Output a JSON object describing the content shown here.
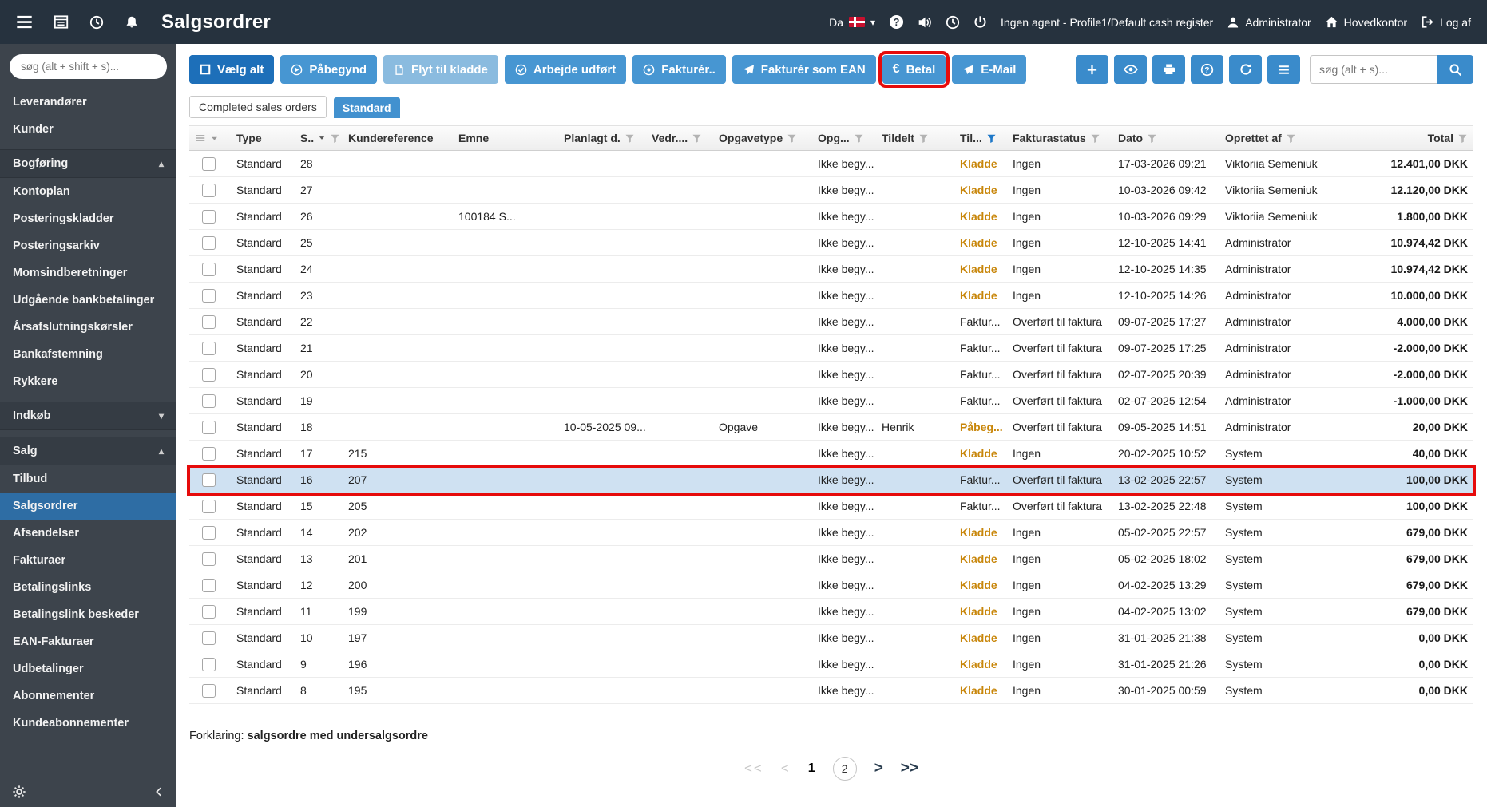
{
  "topbar": {
    "title": "Salgsordrer",
    "language": "Da",
    "agent_status": "Ingen agent - Profile1/Default cash register",
    "user": "Administrator",
    "location": "Hovedkontor",
    "logout_label": "Log af"
  },
  "sidebar": {
    "search_placeholder": "søg (alt + shift + s)...",
    "items": [
      {
        "label": "Leverandører",
        "type": "link"
      },
      {
        "label": "Kunder",
        "type": "link"
      },
      {
        "label": "Bogføring",
        "type": "section",
        "state": "expanded"
      },
      {
        "label": "Kontoplan",
        "type": "child"
      },
      {
        "label": "Posteringskladder",
        "type": "child"
      },
      {
        "label": "Posteringsarkiv",
        "type": "child"
      },
      {
        "label": "Momsindberetninger",
        "type": "child"
      },
      {
        "label": "Udgående bankbetalinger",
        "type": "child"
      },
      {
        "label": "Årsafslutningskørsler",
        "type": "child"
      },
      {
        "label": "Bankafstemning",
        "type": "child"
      },
      {
        "label": "Rykkere",
        "type": "child"
      },
      {
        "label": "Indkøb",
        "type": "section",
        "state": "collapsed"
      },
      {
        "label": "Salg",
        "type": "section",
        "state": "expanded"
      },
      {
        "label": "Tilbud",
        "type": "child"
      },
      {
        "label": "Salgsordrer",
        "type": "child",
        "active": true
      },
      {
        "label": "Afsendelser",
        "type": "child"
      },
      {
        "label": "Fakturaer",
        "type": "child"
      },
      {
        "label": "Betalingslinks",
        "type": "child"
      },
      {
        "label": "Betalingslink beskeder",
        "type": "child"
      },
      {
        "label": "EAN-Fakturaer",
        "type": "child"
      },
      {
        "label": "Udbetalinger",
        "type": "child"
      },
      {
        "label": "Abonnementer",
        "type": "child"
      },
      {
        "label": "Kundeabonnementer",
        "type": "child"
      }
    ]
  },
  "toolbar": {
    "actions": [
      {
        "label": "Vælg alt",
        "icon": "select-all",
        "style": "dark",
        "annotated": false
      },
      {
        "label": "Påbegynd",
        "icon": "play",
        "style": "mid",
        "annotated": false
      },
      {
        "label": "Flyt til kladde",
        "icon": "draft",
        "style": "light",
        "annotated": false
      },
      {
        "label": "Arbejde udført",
        "icon": "done",
        "style": "mid",
        "annotated": false
      },
      {
        "label": "Fakturér..",
        "icon": "invoice",
        "style": "mid",
        "annotated": false
      },
      {
        "label": "Fakturér som EAN",
        "icon": "send",
        "style": "mid",
        "annotated": false
      },
      {
        "label": "Betal",
        "icon": "euro",
        "style": "mid",
        "annotated": true
      },
      {
        "label": "E-Mail",
        "icon": "send",
        "style": "mid",
        "annotated": false
      }
    ],
    "tools": [
      "plus",
      "eye",
      "printer",
      "question",
      "refresh",
      "list"
    ],
    "search_placeholder": "søg (alt + s)..."
  },
  "tabs": [
    {
      "label": "Completed sales orders",
      "active": false
    },
    {
      "label": "Standard",
      "active": true
    }
  ],
  "table": {
    "columns": [
      {
        "label": "",
        "kind": "select"
      },
      {
        "label": "Type"
      },
      {
        "label": "S..",
        "sort": "desc",
        "filter": true
      },
      {
        "label": "Kundereference"
      },
      {
        "label": "Emne"
      },
      {
        "label": "Planlagt d.",
        "filter": true
      },
      {
        "label": "Vedr....",
        "filter": true
      },
      {
        "label": "Opgavetype",
        "filter": true
      },
      {
        "label": "Opg...",
        "filter": true
      },
      {
        "label": "Tildelt",
        "filter": true
      },
      {
        "label": "Til...",
        "filter": true,
        "filter_active": true
      },
      {
        "label": "Fakturastatus",
        "filter": true
      },
      {
        "label": "Dato",
        "filter": true
      },
      {
        "label": "Oprettet af",
        "filter": true
      },
      {
        "label": "Total",
        "filter": true,
        "align": "right"
      }
    ],
    "rows": [
      {
        "type": "Standard",
        "s": "28",
        "ref": "",
        "emne": "",
        "planlagt": "",
        "vedr": "",
        "opgavetype": "",
        "opg": "Ikke begy...",
        "tildelt": "",
        "status": "Kladde",
        "status_kind": "kladde",
        "fakturastatus": "Ingen",
        "dato": "17-03-2026 09:21",
        "oprettet": "Viktoriia Semeniuk",
        "total": "12.401,00 DKK",
        "selected": false,
        "annotated": false
      },
      {
        "type": "Standard",
        "s": "27",
        "ref": "",
        "emne": "",
        "planlagt": "",
        "vedr": "",
        "opgavetype": "",
        "opg": "Ikke begy...",
        "tildelt": "",
        "status": "Kladde",
        "status_kind": "kladde",
        "fakturastatus": "Ingen",
        "dato": "10-03-2026 09:42",
        "oprettet": "Viktoriia Semeniuk",
        "total": "12.120,00 DKK",
        "selected": false,
        "annotated": false
      },
      {
        "type": "Standard",
        "s": "26",
        "ref": "",
        "emne": "100184 S...",
        "planlagt": "",
        "vedr": "",
        "opgavetype": "",
        "opg": "Ikke begy...",
        "tildelt": "",
        "status": "Kladde",
        "status_kind": "kladde",
        "fakturastatus": "Ingen",
        "dato": "10-03-2026 09:29",
        "oprettet": "Viktoriia Semeniuk",
        "total": "1.800,00 DKK",
        "selected": false,
        "annotated": false
      },
      {
        "type": "Standard",
        "s": "25",
        "ref": "",
        "emne": "",
        "planlagt": "",
        "vedr": "",
        "opgavetype": "",
        "opg": "Ikke begy...",
        "tildelt": "",
        "status": "Kladde",
        "status_kind": "kladde",
        "fakturastatus": "Ingen",
        "dato": "12-10-2025 14:41",
        "oprettet": "Administrator",
        "total": "10.974,42 DKK",
        "selected": false,
        "annotated": false
      },
      {
        "type": "Standard",
        "s": "24",
        "ref": "",
        "emne": "",
        "planlagt": "",
        "vedr": "",
        "opgavetype": "",
        "opg": "Ikke begy...",
        "tildelt": "",
        "status": "Kladde",
        "status_kind": "kladde",
        "fakturastatus": "Ingen",
        "dato": "12-10-2025 14:35",
        "oprettet": "Administrator",
        "total": "10.974,42 DKK",
        "selected": false,
        "annotated": false
      },
      {
        "type": "Standard",
        "s": "23",
        "ref": "",
        "emne": "",
        "planlagt": "",
        "vedr": "",
        "opgavetype": "",
        "opg": "Ikke begy...",
        "tildelt": "",
        "status": "Kladde",
        "status_kind": "kladde",
        "fakturastatus": "Ingen",
        "dato": "12-10-2025 14:26",
        "oprettet": "Administrator",
        "total": "10.000,00 DKK",
        "selected": false,
        "annotated": false
      },
      {
        "type": "Standard",
        "s": "22",
        "ref": "",
        "emne": "",
        "planlagt": "",
        "vedr": "",
        "opgavetype": "",
        "opg": "Ikke begy...",
        "tildelt": "",
        "status": "Faktur...",
        "status_kind": "faktur",
        "fakturastatus": "Overført til faktura",
        "dato": "09-07-2025 17:27",
        "oprettet": "Administrator",
        "total": "4.000,00 DKK",
        "selected": false,
        "annotated": false
      },
      {
        "type": "Standard",
        "s": "21",
        "ref": "",
        "emne": "",
        "planlagt": "",
        "vedr": "",
        "opgavetype": "",
        "opg": "Ikke begy...",
        "tildelt": "",
        "status": "Faktur...",
        "status_kind": "faktur",
        "fakturastatus": "Overført til faktura",
        "dato": "09-07-2025 17:25",
        "oprettet": "Administrator",
        "total": "-2.000,00 DKK",
        "selected": false,
        "annotated": false
      },
      {
        "type": "Standard",
        "s": "20",
        "ref": "",
        "emne": "",
        "planlagt": "",
        "vedr": "",
        "opgavetype": "",
        "opg": "Ikke begy...",
        "tildelt": "",
        "status": "Faktur...",
        "status_kind": "faktur",
        "fakturastatus": "Overført til faktura",
        "dato": "02-07-2025 20:39",
        "oprettet": "Administrator",
        "total": "-2.000,00 DKK",
        "selected": false,
        "annotated": false
      },
      {
        "type": "Standard",
        "s": "19",
        "ref": "",
        "emne": "",
        "planlagt": "",
        "vedr": "",
        "opgavetype": "",
        "opg": "Ikke begy...",
        "tildelt": "",
        "status": "Faktur...",
        "status_kind": "faktur",
        "fakturastatus": "Overført til faktura",
        "dato": "02-07-2025 12:54",
        "oprettet": "Administrator",
        "total": "-1.000,00 DKK",
        "selected": false,
        "annotated": false
      },
      {
        "type": "Standard",
        "s": "18",
        "ref": "",
        "emne": "",
        "planlagt": "10-05-2025 09...",
        "vedr": "",
        "opgavetype": "Opgave",
        "opg": "Ikke begy...",
        "tildelt": "Henrik",
        "status": "Påbeg...",
        "status_kind": "paabeg",
        "fakturastatus": "Overført til faktura",
        "dato": "09-05-2025 14:51",
        "oprettet": "Administrator",
        "total": "20,00 DKK",
        "selected": false,
        "annotated": false
      },
      {
        "type": "Standard",
        "s": "17",
        "ref": "215",
        "emne": "",
        "planlagt": "",
        "vedr": "",
        "opgavetype": "",
        "opg": "Ikke begy...",
        "tildelt": "",
        "status": "Kladde",
        "status_kind": "kladde",
        "fakturastatus": "Ingen",
        "dato": "20-02-2025 10:52",
        "oprettet": "System",
        "total": "40,00 DKK",
        "selected": false,
        "annotated": false
      },
      {
        "type": "Standard",
        "s": "16",
        "ref": "207",
        "emne": "",
        "planlagt": "",
        "vedr": "",
        "opgavetype": "",
        "opg": "Ikke begy...",
        "tildelt": "",
        "status": "Faktur...",
        "status_kind": "faktur",
        "fakturastatus": "Overført til faktura",
        "dato": "13-02-2025 22:57",
        "oprettet": "System",
        "total": "100,00 DKK",
        "selected": true,
        "annotated": true
      },
      {
        "type": "Standard",
        "s": "15",
        "ref": "205",
        "emne": "",
        "planlagt": "",
        "vedr": "",
        "opgavetype": "",
        "opg": "Ikke begy...",
        "tildelt": "",
        "status": "Faktur...",
        "status_kind": "faktur",
        "fakturastatus": "Overført til faktura",
        "dato": "13-02-2025 22:48",
        "oprettet": "System",
        "total": "100,00 DKK",
        "selected": false,
        "annotated": false
      },
      {
        "type": "Standard",
        "s": "14",
        "ref": "202",
        "emne": "",
        "planlagt": "",
        "vedr": "",
        "opgavetype": "",
        "opg": "Ikke begy...",
        "tildelt": "",
        "status": "Kladde",
        "status_kind": "kladde",
        "fakturastatus": "Ingen",
        "dato": "05-02-2025 22:57",
        "oprettet": "System",
        "total": "679,00 DKK",
        "selected": false,
        "annotated": false
      },
      {
        "type": "Standard",
        "s": "13",
        "ref": "201",
        "emne": "",
        "planlagt": "",
        "vedr": "",
        "opgavetype": "",
        "opg": "Ikke begy...",
        "tildelt": "",
        "status": "Kladde",
        "status_kind": "kladde",
        "fakturastatus": "Ingen",
        "dato": "05-02-2025 18:02",
        "oprettet": "System",
        "total": "679,00 DKK",
        "selected": false,
        "annotated": false
      },
      {
        "type": "Standard",
        "s": "12",
        "ref": "200",
        "emne": "",
        "planlagt": "",
        "vedr": "",
        "opgavetype": "",
        "opg": "Ikke begy...",
        "tildelt": "",
        "status": "Kladde",
        "status_kind": "kladde",
        "fakturastatus": "Ingen",
        "dato": "04-02-2025 13:29",
        "oprettet": "System",
        "total": "679,00 DKK",
        "selected": false,
        "annotated": false
      },
      {
        "type": "Standard",
        "s": "11",
        "ref": "199",
        "emne": "",
        "planlagt": "",
        "vedr": "",
        "opgavetype": "",
        "opg": "Ikke begy...",
        "tildelt": "",
        "status": "Kladde",
        "status_kind": "kladde",
        "fakturastatus": "Ingen",
        "dato": "04-02-2025 13:02",
        "oprettet": "System",
        "total": "679,00 DKK",
        "selected": false,
        "annotated": false
      },
      {
        "type": "Standard",
        "s": "10",
        "ref": "197",
        "emne": "",
        "planlagt": "",
        "vedr": "",
        "opgavetype": "",
        "opg": "Ikke begy...",
        "tildelt": "",
        "status": "Kladde",
        "status_kind": "kladde",
        "fakturastatus": "Ingen",
        "dato": "31-01-2025 21:38",
        "oprettet": "System",
        "total": "0,00 DKK",
        "selected": false,
        "annotated": false
      },
      {
        "type": "Standard",
        "s": "9",
        "ref": "196",
        "emne": "",
        "planlagt": "",
        "vedr": "",
        "opgavetype": "",
        "opg": "Ikke begy...",
        "tildelt": "",
        "status": "Kladde",
        "status_kind": "kladde",
        "fakturastatus": "Ingen",
        "dato": "31-01-2025 21:26",
        "oprettet": "System",
        "total": "0,00 DKK",
        "selected": false,
        "annotated": false
      },
      {
        "type": "Standard",
        "s": "8",
        "ref": "195",
        "emne": "",
        "planlagt": "",
        "vedr": "",
        "opgavetype": "",
        "opg": "Ikke begy...",
        "tildelt": "",
        "status": "Kladde",
        "status_kind": "kladde",
        "fakturastatus": "Ingen",
        "dato": "30-01-2025 00:59",
        "oprettet": "System",
        "total": "0,00 DKK",
        "selected": false,
        "annotated": false
      }
    ]
  },
  "footer": {
    "legend_label": "Forklaring:",
    "legend_text": "salgsordre med undersalgsordre",
    "pagination": [
      {
        "label": "<<",
        "kind": "nav-disabled",
        "name": "first-page-button"
      },
      {
        "label": "<",
        "kind": "nav-disabled",
        "name": "prev-page-button"
      },
      {
        "label": "1",
        "kind": "page-active",
        "name": "page-1-button"
      },
      {
        "label": "2",
        "kind": "page",
        "name": "page-2-button"
      },
      {
        "label": ">",
        "kind": "nav",
        "name": "next-page-button"
      },
      {
        "label": ">>",
        "kind": "nav",
        "name": "last-page-button"
      }
    ]
  },
  "colors": {
    "annotation_red": "#e60b0b",
    "status_orange": "#c8860a",
    "accent_blue": "#4796d2",
    "selected_row": "#cfe1f2"
  }
}
